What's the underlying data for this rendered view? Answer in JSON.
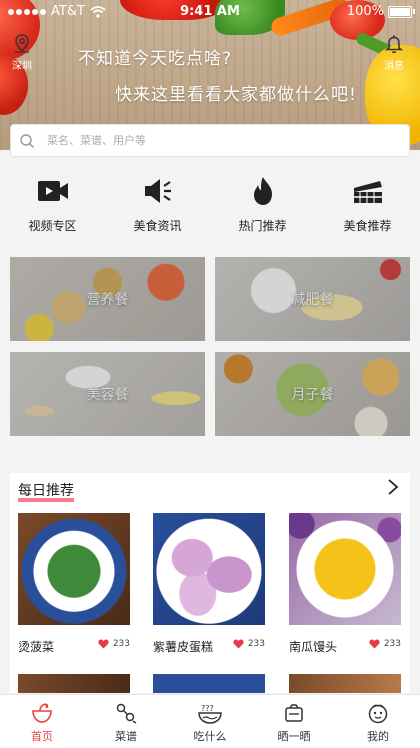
{
  "status_bar": {
    "carrier": "AT&T",
    "time": "9:41 AM",
    "battery": "100%"
  },
  "hero": {
    "city_label": "深圳",
    "message_label": "消息",
    "line1": "不知道今天吃点啥?",
    "line2": "快来这里看看大家都做什么吧!"
  },
  "search": {
    "placeholder": "菜名、菜谱、用户等",
    "value": ""
  },
  "categories": [
    {
      "label": "视频专区",
      "icon": "video-icon"
    },
    {
      "label": "美食资讯",
      "icon": "megaphone-icon"
    },
    {
      "label": "热门推荐",
      "icon": "flame-icon"
    },
    {
      "label": "美食推荐",
      "icon": "cake-icon"
    }
  ],
  "meal_tiles": [
    {
      "label": "营养餐"
    },
    {
      "label": "减肥餐"
    },
    {
      "label": "美容餐"
    },
    {
      "label": "月子餐"
    }
  ],
  "daily": {
    "title": "每日推荐",
    "items": [
      {
        "name": "烫菠菜",
        "likes": "233"
      },
      {
        "name": "紫薯皮蛋糕",
        "likes": "233"
      },
      {
        "name": "南瓜馒头",
        "likes": "233"
      }
    ]
  },
  "tabbar": {
    "items": [
      {
        "label": "首页",
        "icon": "home-bowl-icon",
        "active": true
      },
      {
        "label": "菜谱",
        "icon": "recipe-icon"
      },
      {
        "label": "吃什么",
        "icon": "question-bowl-icon"
      },
      {
        "label": "晒一晒",
        "icon": "camera-bowl-icon"
      },
      {
        "label": "我的",
        "icon": "profile-icon"
      }
    ]
  },
  "colors": {
    "accent": "#e8413a",
    "heart": "#e83a4a",
    "underline": "#f47c87"
  }
}
